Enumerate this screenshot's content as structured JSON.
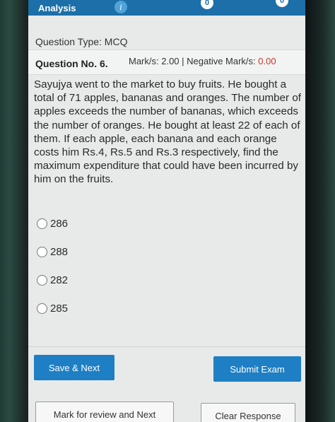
{
  "header": {
    "title": "Analysis",
    "info_icon": "i",
    "nav_icon_1": "0",
    "nav_icon_2": "0"
  },
  "question": {
    "type_label": "Question Type: MCQ",
    "number_label": "Question No. 6.",
    "marks_prefix": "Mark/s: 2.00 | Negative Mark/s: ",
    "negative_marks_value": "0.00",
    "text": "Sayujya went to the market to buy fruits. He bought a total of 71 apples, bananas and oranges. The number of apples exceeds the number of bananas, which exceeds the number of oranges. He bought at least 22 of each of them. If each apple, each banana and each orange costs him Rs.4, Rs.5 and Rs.3 respectively, find the maximum expenditure that could have been incurred by him on the fruits."
  },
  "options": [
    {
      "label": "286"
    },
    {
      "label": "288"
    },
    {
      "label": "282"
    },
    {
      "label": "285"
    }
  ],
  "actions": {
    "save_next": "Save & Next",
    "submit_exam": "Submit Exam",
    "mark_review_next": "Mark for review and Next",
    "clear_response": "Clear Response"
  },
  "colors": {
    "primary_blue": "#1e7fc4",
    "negative_red": "#c0392b"
  }
}
